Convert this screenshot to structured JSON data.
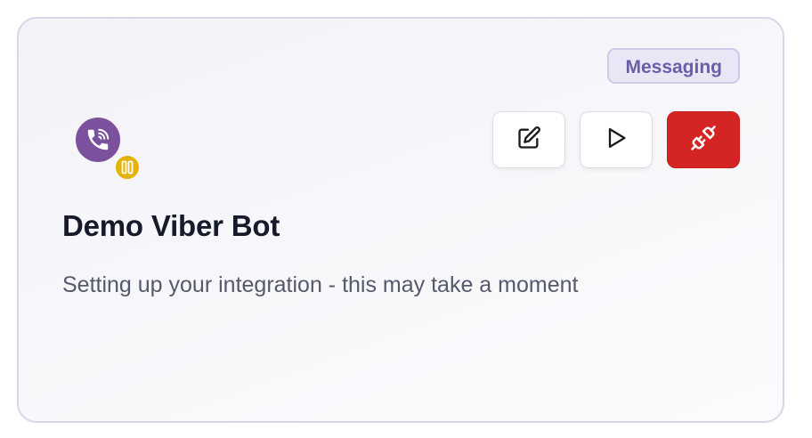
{
  "integration": {
    "category_badge": "Messaging",
    "name": "Demo Viber Bot",
    "status_message": "Setting up your integration - this may take a moment",
    "service_icon": "viber-icon",
    "status_icon": "pause-icon"
  },
  "actions": [
    {
      "icon": "edit-icon",
      "style": "light"
    },
    {
      "icon": "play-icon",
      "style": "light"
    },
    {
      "icon": "disconnect-plug-icon",
      "style": "danger"
    }
  ],
  "colors": {
    "viber_purple": "#7b519d",
    "status_pending": "#e3b30b",
    "danger": "#d42424",
    "badge_text": "#6a5fa6"
  }
}
